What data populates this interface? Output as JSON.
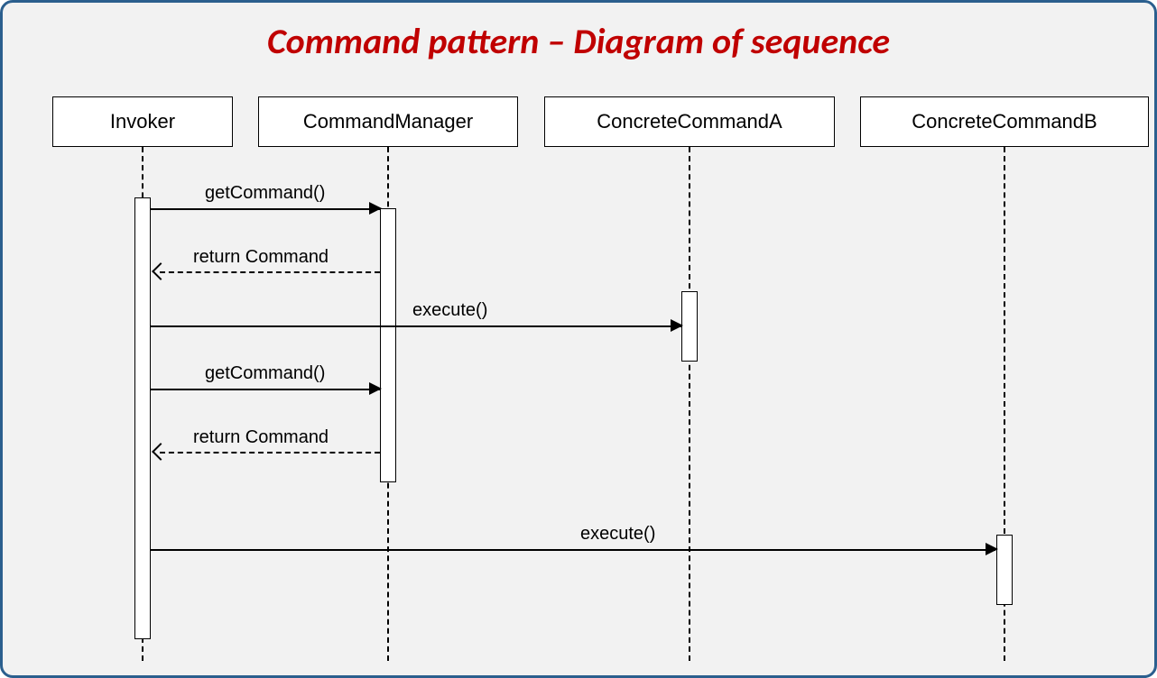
{
  "title": "Command pattern – Diagram of sequence",
  "participants": {
    "invoker": "Invoker",
    "manager": "CommandManager",
    "cmdA": "ConcreteCommandA",
    "cmdB": "ConcreteCommandB"
  },
  "messages": {
    "getCommand1": "getCommand()",
    "returnCommand1": "return Command",
    "execute1": "execute()",
    "getCommand2": "getCommand()",
    "returnCommand2": "return Command",
    "execute2": "execute()"
  }
}
